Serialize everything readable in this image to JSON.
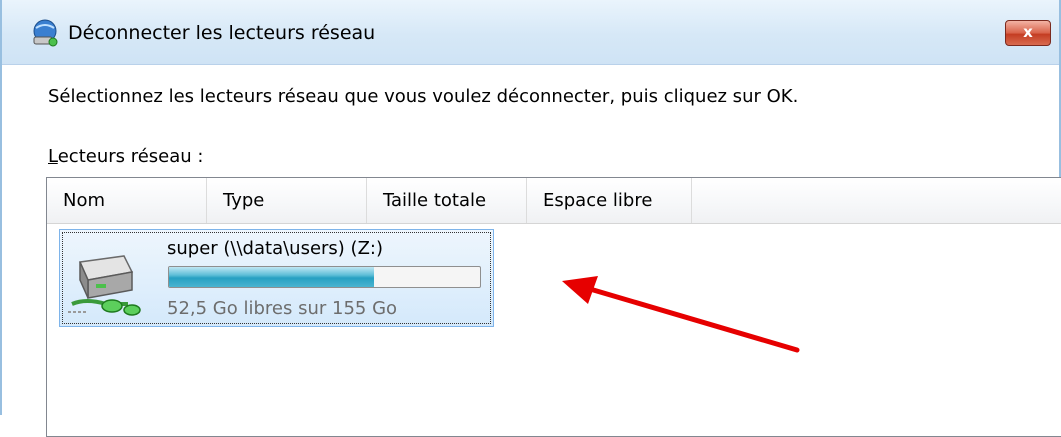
{
  "window": {
    "title": "Déconnecter les lecteurs réseau",
    "close_label": "x"
  },
  "instruction": "Sélectionnez les lecteurs réseau que vous voulez déconnecter, puis cliquez sur OK.",
  "list": {
    "label_accel": "L",
    "label_rest": "ecteurs réseau :",
    "columns": [
      "Nom",
      "Type",
      "Taille totale",
      "Espace libre"
    ],
    "items": [
      {
        "name": "super (\\\\data\\users) (Z:)",
        "free_text": "52,5 Go libres sur 155 Go",
        "used_fraction": 0.66,
        "selected": true
      }
    ]
  },
  "colors": {
    "selection_border": "#7eb4ea",
    "usage_fill": "#26a0c2",
    "annotation_arrow": "#e60000"
  },
  "icons": {
    "title_icon": "network-drive-icon",
    "drive_icon": "network-drive-icon"
  }
}
